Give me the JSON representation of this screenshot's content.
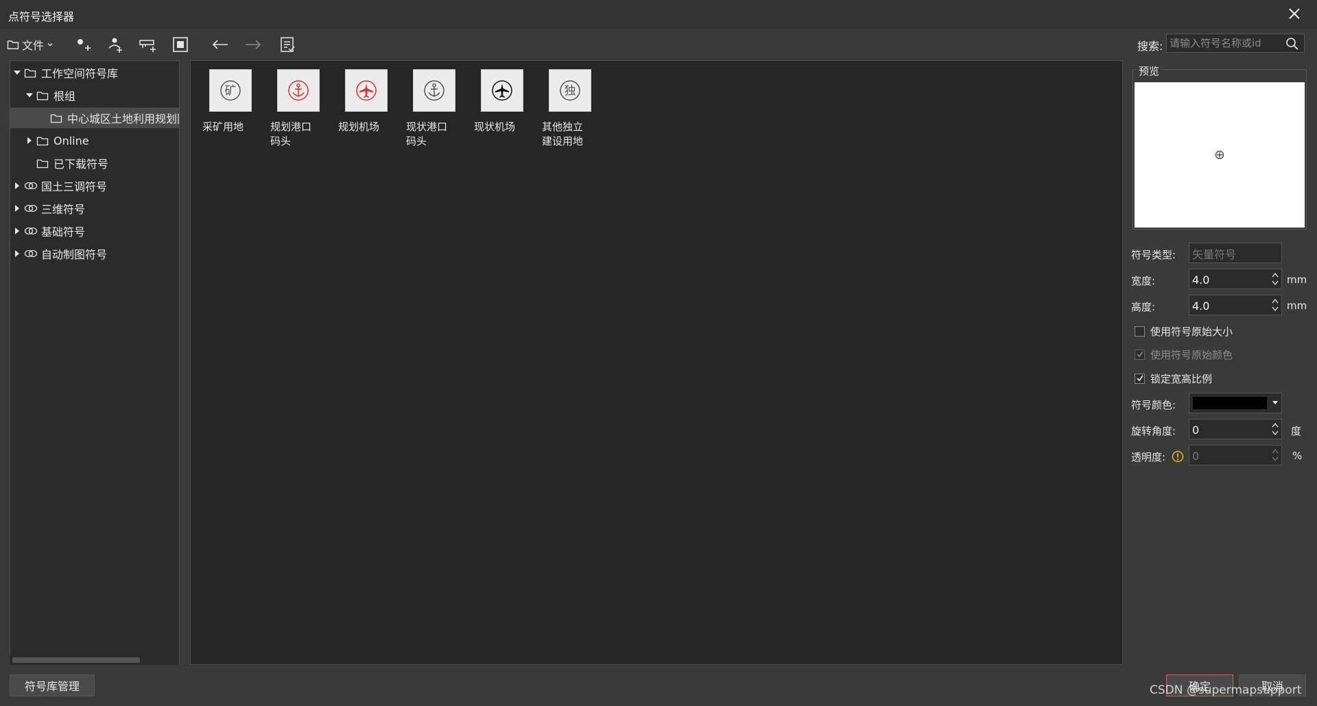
{
  "window": {
    "title": "点符号选择器"
  },
  "toolbar": {
    "file_label": "文件",
    "search_label": "搜索:",
    "search_placeholder": "请输入符号名称或id"
  },
  "tree": {
    "items": [
      {
        "label": "工作空间符号库",
        "icon": "folder-icon",
        "expanded": true
      },
      {
        "label": "根组",
        "icon": "folder-icon",
        "expanded": true
      },
      {
        "label": "中心城区土地利用规划图",
        "icon": "folder-icon",
        "selected": true
      },
      {
        "label": "Online",
        "icon": "folder-icon",
        "expanded": false
      },
      {
        "label": "已下载符号",
        "icon": "folder-icon"
      },
      {
        "label": "国土三调符号",
        "icon": "link-icon",
        "expanded": false
      },
      {
        "label": "三维符号",
        "icon": "link-icon",
        "expanded": false
      },
      {
        "label": "基础符号",
        "icon": "link-icon",
        "expanded": false
      },
      {
        "label": "自动制图符号",
        "icon": "link-icon",
        "expanded": false
      }
    ]
  },
  "symbols": [
    {
      "line1": "采矿用地",
      "line2": "",
      "glyph": "矿",
      "color": "#555555"
    },
    {
      "line1": "规划港口",
      "line2": "码头",
      "glyph": "anchor",
      "color": "#e03030"
    },
    {
      "line1": "规划机场",
      "line2": "",
      "glyph": "plane",
      "color": "#e03030"
    },
    {
      "line1": "现状港口",
      "line2": "码头",
      "glyph": "anchor",
      "color": "#555555"
    },
    {
      "line1": "现状机场",
      "line2": "",
      "glyph": "plane",
      "color": "#111111"
    },
    {
      "line1": "其他独立",
      "line2": "建设用地",
      "glyph": "独",
      "color": "#555555"
    }
  ],
  "properties": {
    "preview_label": "预览",
    "type_label": "符号类型:",
    "type_value": "矢量符号",
    "width_label": "宽度:",
    "width_value": "4.0",
    "width_unit": "mm",
    "height_label": "高度:",
    "height_value": "4.0",
    "height_unit": "mm",
    "use_original_size": "使用符号原始大小",
    "use_original_color": "使用符号原始颜色",
    "lock_ratio": "锁定宽高比例",
    "color_label": "符号颜色:",
    "color_value": "#000000",
    "rotation_label": "旋转角度:",
    "rotation_value": "0",
    "rotation_unit": "度",
    "opacity_label": "透明度:",
    "opacity_value": "0",
    "opacity_unit": "%"
  },
  "buttons": {
    "library_manage": "符号库管理",
    "ok": "确定",
    "cancel": "取消"
  },
  "watermark": "CSDN @supermapsupport"
}
